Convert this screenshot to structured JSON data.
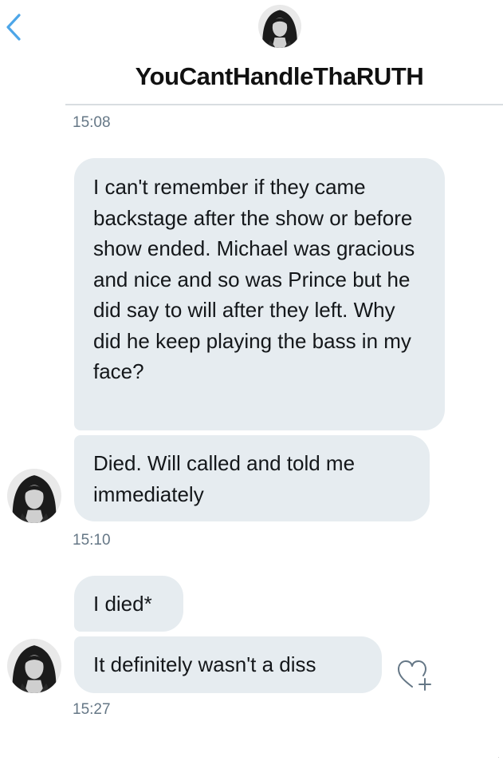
{
  "header": {
    "title": "YouCantHandleThaRUTH",
    "back_icon": "chevron-left-icon",
    "accent_color": "#4da6e8"
  },
  "messages": {
    "ts1": "15:08",
    "m1": "I can't remember if they came backstage after the show or before show ended. Michael was gracious and nice and so was Prince but he did say to will after they left. Why did he keep playing the bass in my face?",
    "m2": "Died. Will called and told me immediately",
    "ts2": "15:10",
    "m3": "I died*",
    "m4": "It definitely wasn't a diss",
    "ts3": "15:27"
  },
  "colors": {
    "bubble_bg": "#e6ecf0",
    "timestamp": "#657786",
    "divider": "#d9dde1"
  },
  "icons": {
    "reaction": "heart-plus-icon",
    "avatar": "avatar"
  }
}
